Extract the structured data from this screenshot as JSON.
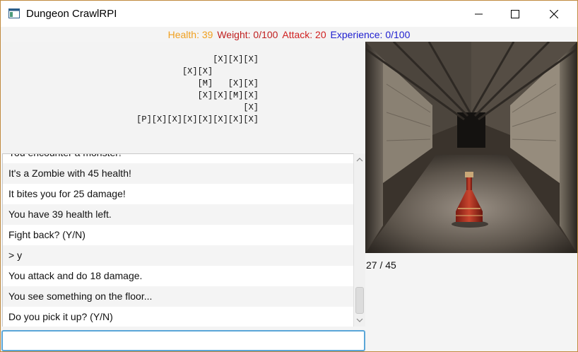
{
  "window": {
    "title": "Dungeon CrawlRPI",
    "icons": {
      "app": "app-window-icon",
      "minimize": "minimize-icon",
      "maximize": "maximize-icon",
      "close": "close-icon"
    }
  },
  "stats": {
    "health": "Health: 39",
    "weight": "Weight: 0/100",
    "attack": "Attack: 20",
    "experience": "Experience: 0/100",
    "colors": {
      "health": "#f0a020",
      "weight": "#c02020",
      "attack": "#d02020",
      "experience": "#2020d0"
    }
  },
  "map": {
    "text": "[X][X][X]\n[X][X]         \n[M]   [X][X]\n[X][X][M][X]\n[X]\n[P][X][X][X][X][X][X][X]"
  },
  "log": {
    "lines": [
      "You encounter a monster!",
      "It's a Zombie with 45 health!",
      "It bites you for 25 damage!",
      "You have 39 health left.",
      "Fight back? (Y/N)",
      "> y",
      "You attack and do 18 damage.",
      "You see something on the floor...",
      "Do you pick it up? (Y/N)"
    ]
  },
  "input": {
    "value": "",
    "placeholder": ""
  },
  "scene": {
    "subject": "potion-bottle-in-corridor"
  },
  "counter": "27 / 45"
}
